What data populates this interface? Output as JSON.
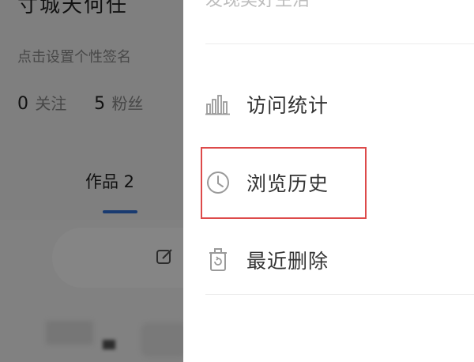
{
  "profile": {
    "name": "寸城天何任",
    "signature": "点击设置个性签名",
    "stats": [
      {
        "count": "0",
        "label": "关注"
      },
      {
        "count": "5",
        "label": "粉丝"
      }
    ],
    "tab_label": "作品 2"
  },
  "drawer": {
    "top_item": "发现美好生活",
    "items": [
      {
        "label": "访问统计",
        "icon": "bar-chart-icon"
      },
      {
        "label": "浏览历史",
        "icon": "clock-icon"
      },
      {
        "label": "最近删除",
        "icon": "trash-icon"
      }
    ]
  },
  "colors": {
    "highlight": "#dd4a4a",
    "accent": "#2f6fd6",
    "overlay": "rgba(0,0,0,0.48)"
  }
}
